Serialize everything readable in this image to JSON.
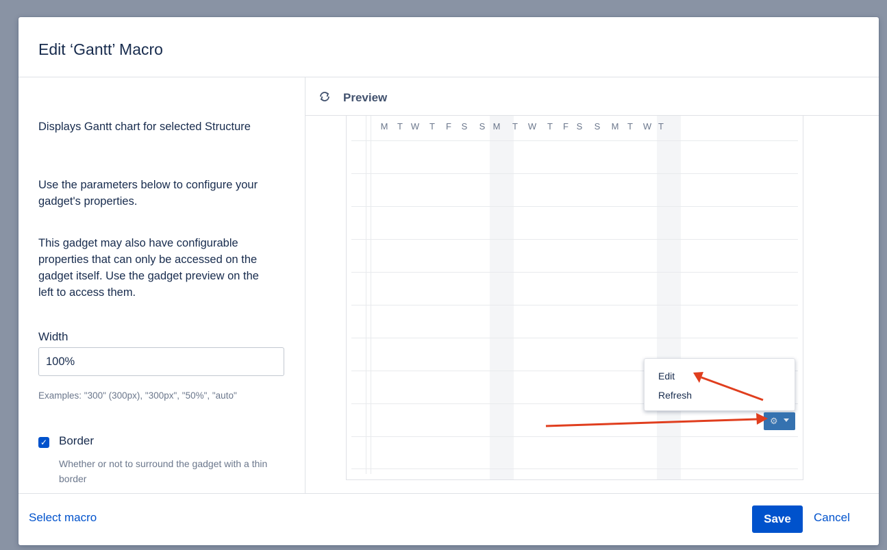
{
  "dialog": {
    "title": "Edit ‘Gantt’ Macro"
  },
  "left_panel": {
    "description_1": "Displays Gantt chart for selected Structure",
    "description_2": "Use the parameters below to configure your gadget's properties.",
    "description_3": "This gadget may also have configurable properties that can only be accessed on the gadget itself. Use the gadget preview on the left to access them.",
    "width": {
      "label": "Width",
      "value": "100%",
      "hint": "Examples: \"300\" (300px), \"300px\", \"50%\", \"auto\""
    },
    "border": {
      "label": "Border",
      "checked": true,
      "description": "Whether or not to surround the gadget with a thin border"
    }
  },
  "preview": {
    "label": "Preview",
    "icon": "refresh-icon",
    "days": [
      "M",
      "T",
      "W",
      "T",
      "F",
      "S",
      "S",
      "M",
      "T",
      "W",
      "T",
      "F",
      "S",
      "S",
      "M",
      "T",
      "W",
      "T"
    ],
    "weekend_color": "#f4f5f7",
    "menu_items": [
      "Edit",
      "Refresh"
    ],
    "gear_button": {
      "icon": "gear-icon",
      "caret_icon": "caret-down-icon"
    },
    "annotation_arrow_color": "#e03e1e"
  },
  "footer": {
    "select_macro": "Select macro",
    "save": "Save",
    "cancel": "Cancel"
  },
  "colors": {
    "accent": "#0052cc",
    "overlay": "#8993a4",
    "gadget_button": "#3572b0"
  }
}
